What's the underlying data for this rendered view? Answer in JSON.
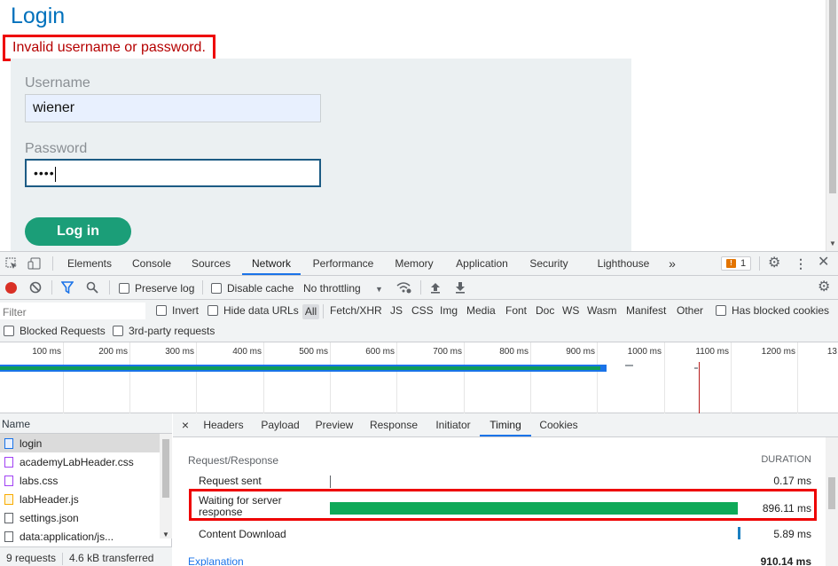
{
  "page": {
    "title": "Login",
    "error": "Invalid username or password.",
    "username_label": "Username",
    "username_value": "wiener",
    "password_label": "Password",
    "password_value": "••••",
    "login_button": "Log in"
  },
  "devtools": {
    "tabs": [
      "Elements",
      "Console",
      "Sources",
      "Network",
      "Performance",
      "Memory",
      "Application",
      "Security",
      "Lighthouse"
    ],
    "active_tab": "Network",
    "more_tabs": "»",
    "issues_count": "1",
    "toolbar": {
      "preserve_log": "Preserve log",
      "disable_cache": "Disable cache",
      "throttling": "No throttling"
    },
    "filter": {
      "placeholder": "Filter",
      "invert": "Invert",
      "hide_data_urls": "Hide data URLs",
      "all": "All",
      "types": [
        "Fetch/XHR",
        "JS",
        "CSS",
        "Img",
        "Media",
        "Font",
        "Doc",
        "WS",
        "Wasm",
        "Manifest",
        "Other"
      ],
      "has_blocked_cookies": "Has blocked cookies",
      "blocked_requests": "Blocked Requests",
      "third_party": "3rd-party requests"
    },
    "overview_ticks": [
      "100 ms",
      "200 ms",
      "300 ms",
      "400 ms",
      "500 ms",
      "600 ms",
      "700 ms",
      "800 ms",
      "900 ms",
      "1000 ms",
      "1100 ms",
      "1200 ms",
      "13"
    ],
    "requests": {
      "header": "Name",
      "items": [
        "login",
        "academyLabHeader.css",
        "labs.css",
        "labHeader.js",
        "settings.json",
        "data:application/js..."
      ],
      "selected": "login",
      "count": "9 requests",
      "transferred": "4.6 kB transferred"
    },
    "details": {
      "close": "×",
      "tabs": [
        "Headers",
        "Payload",
        "Preview",
        "Response",
        "Initiator",
        "Timing",
        "Cookies"
      ],
      "active_tab": "Timing",
      "timing": {
        "section": "Request/Response",
        "duration_header": "DURATION",
        "rows": [
          {
            "label": "Request sent",
            "value": "0.17 ms"
          },
          {
            "label": "Waiting for server response",
            "value": "896.11 ms"
          },
          {
            "label": "Content Download",
            "value": "5.89 ms"
          }
        ],
        "explanation": "Explanation",
        "total": "910.14 ms"
      }
    }
  },
  "colors": {
    "brand_blue": "#0071bc",
    "error_red": "#e00000",
    "login_green": "#1b9e78",
    "waiting_green": "#0fa958",
    "devtools_accent": "#1a73e8"
  }
}
